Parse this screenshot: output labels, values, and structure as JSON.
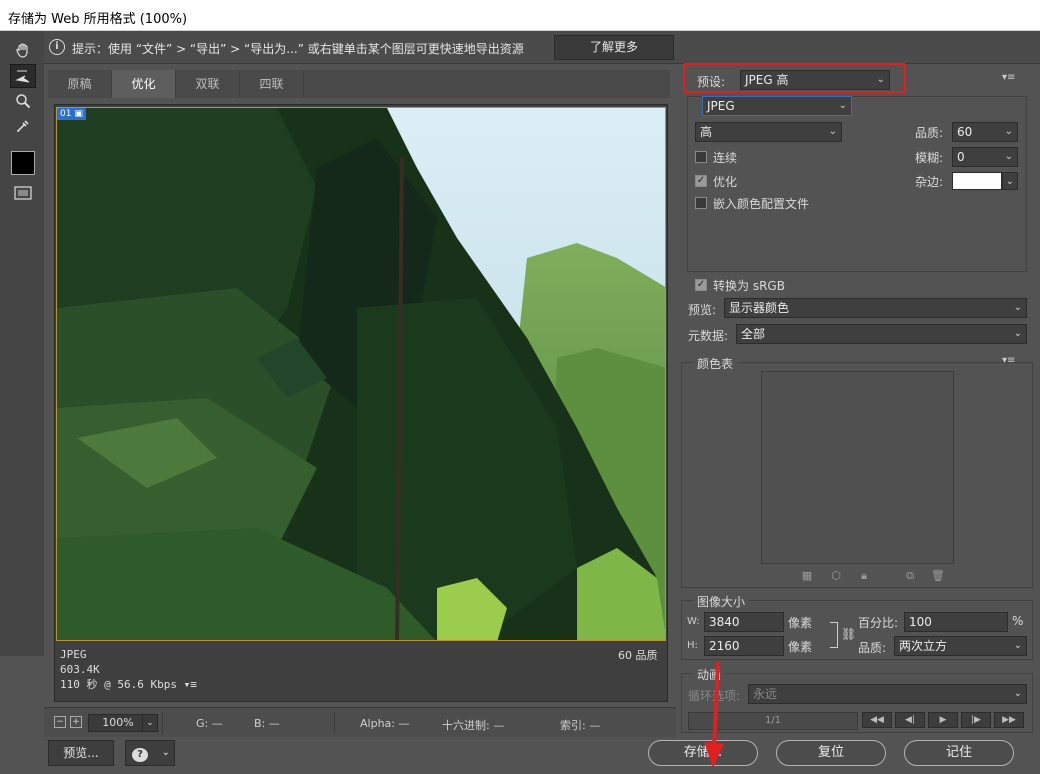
{
  "window": {
    "title": "存储为 Web 所用格式 (100%)"
  },
  "hint": {
    "text": "提示：使用 “文件” > “导出” > “导出为...” 或右键单击某个图层可更快速地导出资源",
    "learn_more": "了解更多"
  },
  "tabs": [
    "原稿",
    "优化",
    "双联",
    "四联"
  ],
  "active_tab": "优化",
  "image": {
    "tag": "01",
    "format": "JPEG",
    "size": "603.4K",
    "time": "110 秒 @ 56.6 Kbps",
    "quality_label": "60 品质"
  },
  "status_bar": {
    "zoom": "100%",
    "g": "G: —",
    "b": "B: —",
    "alpha": "Alpha: —",
    "hex": "十六进制: —",
    "index": "索引: —"
  },
  "bottom_buttons": {
    "preview": "预览...",
    "save": "存储...",
    "reset": "复位",
    "remember": "记住"
  },
  "settings": {
    "preset_label": "预设:",
    "preset_value": "JPEG 高",
    "format_value": "JPEG",
    "quality_level": "高",
    "quality_label": "品质:",
    "quality_value": "60",
    "blur_label": "模糊:",
    "blur_value": "0",
    "matte_label": "杂边:",
    "matte_color": "#ffffff",
    "progressive_label": "连续",
    "progressive_checked": false,
    "optimized_label": "优化",
    "optimized_checked": true,
    "embed_profile_label": "嵌入颜色配置文件",
    "embed_profile_checked": false,
    "convert_srgb_label": "转换为 sRGB",
    "convert_srgb_checked": true,
    "preview_label": "预览:",
    "preview_value": "显示器颜色",
    "metadata_label": "元数据:",
    "metadata_value": "全部"
  },
  "color_table": {
    "title": "颜色表"
  },
  "image_size": {
    "title": "图像大小",
    "w_label": "W:",
    "w_value": "3840",
    "h_label": "H:",
    "h_value": "2160",
    "unit": "像素",
    "percent_label": "百分比:",
    "percent_value": "100",
    "percent_unit": "%",
    "quality_label": "品质:",
    "quality_value": "两次立方"
  },
  "animation": {
    "title": "动画",
    "loop_label": "循环选项:",
    "loop_value": "永远",
    "frame": "1/1"
  },
  "colors": {
    "accent_red": "#e02020",
    "selection_blue": "#2a6fd6"
  }
}
